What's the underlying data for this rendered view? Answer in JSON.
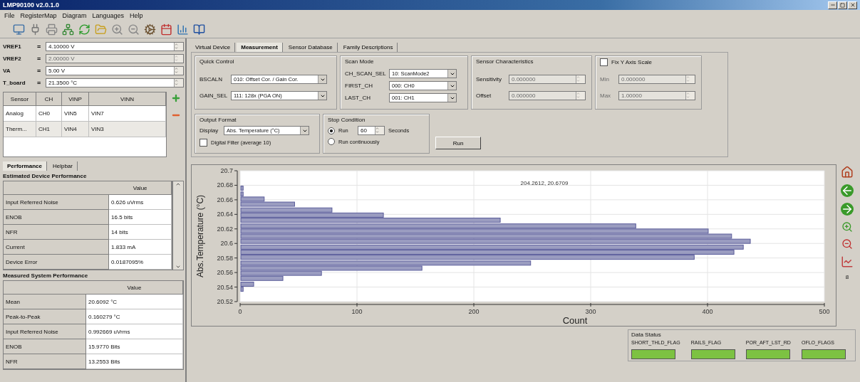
{
  "window": {
    "title": "LMP90100 v2.0.1.0"
  },
  "menu": [
    "File",
    "RegisterMap",
    "Diagram",
    "Languages",
    "Help"
  ],
  "params": [
    {
      "label": "VREF1",
      "eq": "=",
      "value": "4.10000 V",
      "disabled": false
    },
    {
      "label": "VREF2",
      "eq": "=",
      "value": "2.00000 V",
      "disabled": true
    },
    {
      "label": "VA",
      "eq": "=",
      "value": "5.00 V",
      "disabled": false
    },
    {
      "label": "T_board",
      "eq": "=",
      "value": "21.3500 °C",
      "disabled": false
    }
  ],
  "channels": {
    "columns": [
      "Sensor",
      "CH",
      "VINP",
      "VINN"
    ],
    "rows": [
      [
        "Analog",
        "CH0",
        "VIN5",
        "VIN7"
      ],
      [
        "Therm...",
        "CH1",
        "VIN4",
        "VIN3"
      ]
    ]
  },
  "left_tabs": [
    {
      "label": "Performance",
      "selected": true
    },
    {
      "label": "Helpbar",
      "selected": false
    }
  ],
  "estimated": {
    "title": "Estimated Device Performance",
    "value_header": "Value",
    "rows": [
      [
        "Input Referred Noise",
        "0.626 uVrms"
      ],
      [
        "ENOB",
        "16.5 bits"
      ],
      [
        "NFR",
        "14 bits"
      ],
      [
        "Current",
        "1.833 mA"
      ],
      [
        "Device Error",
        "0.0187095%"
      ]
    ]
  },
  "measured": {
    "title": "Measured System Performance",
    "value_header": "Value",
    "rows": [
      [
        "Mean",
        "20.6092 °C"
      ],
      [
        "Peak-to-Peak",
        "0.160279 °C"
      ],
      [
        "Input Referred Noise",
        "0.992669 uVrms"
      ],
      [
        "ENOB",
        "15.9770 Bits"
      ],
      [
        "NFR",
        "13.2553 Bits"
      ]
    ]
  },
  "tabs": [
    {
      "label": "Virtual Device",
      "selected": false
    },
    {
      "label": "Measurement",
      "selected": true
    },
    {
      "label": "Sensor Database",
      "selected": false
    },
    {
      "label": "Family Descriptions",
      "selected": false
    }
  ],
  "quick_control": {
    "title": "Quick Control",
    "fields": [
      {
        "label": "BSCALN",
        "value": "010: Offset Cor. / Gain Cor."
      },
      {
        "label": "GAIN_SEL",
        "value": "111: 128x (PGA ON)"
      }
    ]
  },
  "scan_mode": {
    "title": "Scan Mode",
    "fields": [
      {
        "label": "CH_SCAN_SEL",
        "value": "10: ScanMode2"
      },
      {
        "label": "FIRST_CH",
        "value": "000: CH0"
      },
      {
        "label": "LAST_CH",
        "value": "001: CH1"
      }
    ]
  },
  "sensor_characteristics": {
    "title": "Sensor Characteristics",
    "fields": [
      {
        "label": "Sensitivity",
        "value": "0.000000",
        "disabled": true
      },
      {
        "label": "Offset",
        "value": "0.000000",
        "disabled": true
      }
    ]
  },
  "fix_y_axis": {
    "label": "Fix Y Axis Scale",
    "checked": false,
    "fields": [
      {
        "label": "Min",
        "value": "0.000000",
        "disabled": true
      },
      {
        "label": "Max",
        "value": "1.00000",
        "disabled": true
      }
    ]
  },
  "output_format": {
    "title": "Output Format",
    "display_label": "Display",
    "display_value": "Abs. Temperature (°C)",
    "filter_label": "Digital Filter (average 10)",
    "filter_checked": false
  },
  "stop_condition": {
    "title": "Stop Condition",
    "options": [
      {
        "label": "Run",
        "selected": true,
        "seconds": "60",
        "unit": "Seconds"
      },
      {
        "label": "Run continuously",
        "selected": false
      }
    ]
  },
  "run_button": "Run",
  "chart": {
    "annotation": "204.2612, 20.6709",
    "chart_data": {
      "type": "bar",
      "orientation": "horizontal",
      "xlabel": "Count",
      "ylabel": "Abs.Temperature (°C)",
      "xlim": [
        0,
        500
      ],
      "ylim": [
        20.52,
        20.7
      ],
      "xticks": [
        0,
        100,
        200,
        300,
        400,
        500
      ],
      "yticks": [
        20.52,
        20.54,
        20.56,
        20.58,
        20.6,
        20.62,
        20.64,
        20.66,
        20.68,
        20.7
      ],
      "grid": true,
      "x": [
        20.676,
        20.668,
        20.661,
        20.654,
        20.646,
        20.639,
        20.632,
        20.624,
        20.617,
        20.61,
        20.603,
        20.595,
        20.588,
        20.581,
        20.573,
        20.566,
        20.559,
        20.552,
        20.544,
        20.537
      ],
      "values": [
        2,
        2,
        20,
        46,
        78,
        122,
        222,
        338,
        400,
        420,
        436,
        430,
        422,
        388,
        248,
        155,
        69,
        36,
        11,
        2
      ]
    }
  },
  "side_tools_label": "8",
  "data_status": {
    "title": "Data Status",
    "flags": [
      {
        "label": "SHORT_THLD_FLAG",
        "color": "#7dc242"
      },
      {
        "label": "RAILS_FLAG",
        "color": "#7dc242"
      },
      {
        "label": "POR_AFT_LST_RD",
        "color": "#7dc242"
      },
      {
        "label": "OFLO_FLAGS",
        "color": "#7dc242"
      }
    ]
  }
}
